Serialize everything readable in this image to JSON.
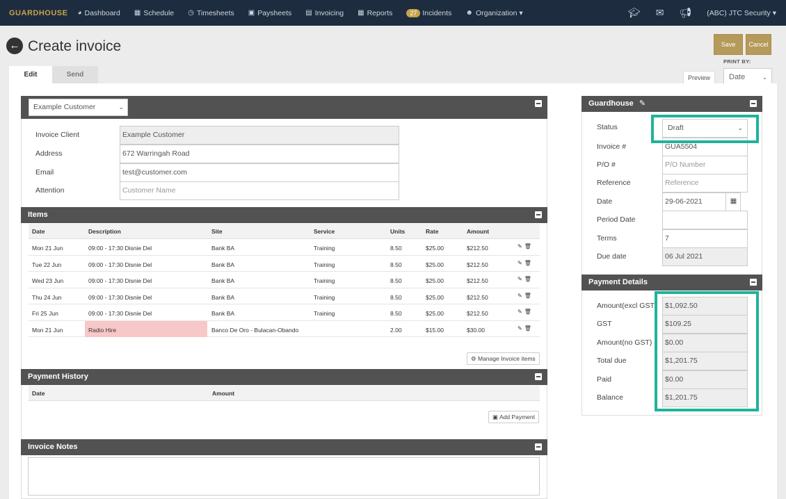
{
  "nav": {
    "brand": "GUARDHOUSE",
    "items": [
      {
        "icon": "dashboard-icon",
        "glyph": "◕",
        "label": "Dashboard"
      },
      {
        "icon": "calendar-icon",
        "glyph": "▦",
        "label": "Schedule"
      },
      {
        "icon": "clock-icon",
        "glyph": "◷",
        "label": "Timesheets"
      },
      {
        "icon": "money-icon",
        "glyph": "▣",
        "label": "Paysheets"
      },
      {
        "icon": "invoice-icon",
        "glyph": "▤",
        "label": "Invoicing"
      },
      {
        "icon": "reports-icon",
        "glyph": "▦",
        "label": "Reports"
      },
      {
        "icon": "incidents-icon",
        "glyph": "",
        "label": "Incidents",
        "badge": "27"
      },
      {
        "icon": "users-icon",
        "glyph": "☻",
        "label": "Organization ▾"
      }
    ],
    "account": "(ABC) JTC Security ▾"
  },
  "header": {
    "title": "Create invoice",
    "save": "Save",
    "cancel": "Cancel",
    "print_by_label": "PRINT BY:",
    "preview": "Preview",
    "print_by_value": "Date"
  },
  "tabs": {
    "edit": "Edit",
    "send": "Send"
  },
  "customer": {
    "selected": "Example Customer",
    "fields": [
      {
        "label": "Invoice Client",
        "value": "Example Customer",
        "ro": true,
        "ph": false
      },
      {
        "label": "Address",
        "value": "672 Warringah Road",
        "ro": false,
        "ph": false
      },
      {
        "label": "Email",
        "value": "test@customer.com",
        "ro": false,
        "ph": false
      },
      {
        "label": "Attention",
        "value": "Customer Name",
        "ro": false,
        "ph": true
      }
    ]
  },
  "items": {
    "title": "Items",
    "headers": {
      "date": "Date",
      "description": "Description",
      "site": "Site",
      "service": "Service",
      "units": "Units",
      "rate": "Rate",
      "amount": "Amount"
    },
    "rows": [
      {
        "date": "Mon 21 Jun",
        "description": "09:00 - 17:30 Disnie Del",
        "site": "Bank BA",
        "service": "Training",
        "units": "8.50",
        "rate": "$25.00",
        "amount": "$212.50",
        "highlight": false
      },
      {
        "date": "Tue 22 Jun",
        "description": "09:00 - 17:30 Disnie Del",
        "site": "Bank BA",
        "service": "Training",
        "units": "8.50",
        "rate": "$25.00",
        "amount": "$212.50",
        "highlight": false
      },
      {
        "date": "Wed 23 Jun",
        "description": "09:00 - 17:30 Disnie Del",
        "site": "Bank BA",
        "service": "Training",
        "units": "8.50",
        "rate": "$25.00",
        "amount": "$212.50",
        "highlight": false
      },
      {
        "date": "Thu 24 Jun",
        "description": "09:00 - 17:30 Disnie Del",
        "site": "Bank BA",
        "service": "Training",
        "units": "8.50",
        "rate": "$25.00",
        "amount": "$212.50",
        "highlight": false
      },
      {
        "date": "Fri 25 Jun",
        "description": "09:00 - 17:30 Disnie Del",
        "site": "Bank BA",
        "service": "Training",
        "units": "8.50",
        "rate": "$25.00",
        "amount": "$212.50",
        "highlight": false
      },
      {
        "date": "Mon 21 Jun",
        "description": "Radio Hire",
        "site": "Banco De Oro - Bulacan-Obando",
        "service": "",
        "units": "2.00",
        "rate": "$15.00",
        "amount": "$30.00",
        "highlight": true
      }
    ],
    "manage_button": "Manage Invoice items"
  },
  "payment_history": {
    "title": "Payment History",
    "headers": {
      "date": "Date",
      "amount": "Amount"
    },
    "add_button": "Add Payment"
  },
  "notes": {
    "title": "Invoice Notes"
  },
  "guardhouse": {
    "title": "Guardhouse",
    "status_label": "Status",
    "status_value": "Draft",
    "fields": [
      {
        "label": "Invoice #",
        "value": "GUA5504",
        "ro": false,
        "ph": false
      },
      {
        "label": "P/O #",
        "value": "P/O Number",
        "ro": false,
        "ph": true
      },
      {
        "label": "Reference",
        "value": "Reference",
        "ro": false,
        "ph": true
      },
      {
        "label": "Date",
        "value": "29-06-2021",
        "ro": false,
        "ph": false
      },
      {
        "label": "Period Date",
        "value": "",
        "ro": false,
        "ph": false
      },
      {
        "label": "Terms",
        "value": "7",
        "ro": false,
        "ph": false
      },
      {
        "label": "Due date",
        "value": "06 Jul 2021",
        "ro": true,
        "ph": false
      }
    ]
  },
  "payment_details": {
    "title": "Payment Details",
    "fields": [
      {
        "label": "Amount(excl GST)",
        "value": "$1,092.50"
      },
      {
        "label": "GST",
        "value": "$109.25"
      },
      {
        "label": "Amount(no GST)",
        "value": "$0.00"
      },
      {
        "label": "Total due",
        "value": "$1,201.75"
      },
      {
        "label": "Paid",
        "value": "$0.00"
      },
      {
        "label": "Balance",
        "value": "$1,201.75"
      }
    ]
  }
}
